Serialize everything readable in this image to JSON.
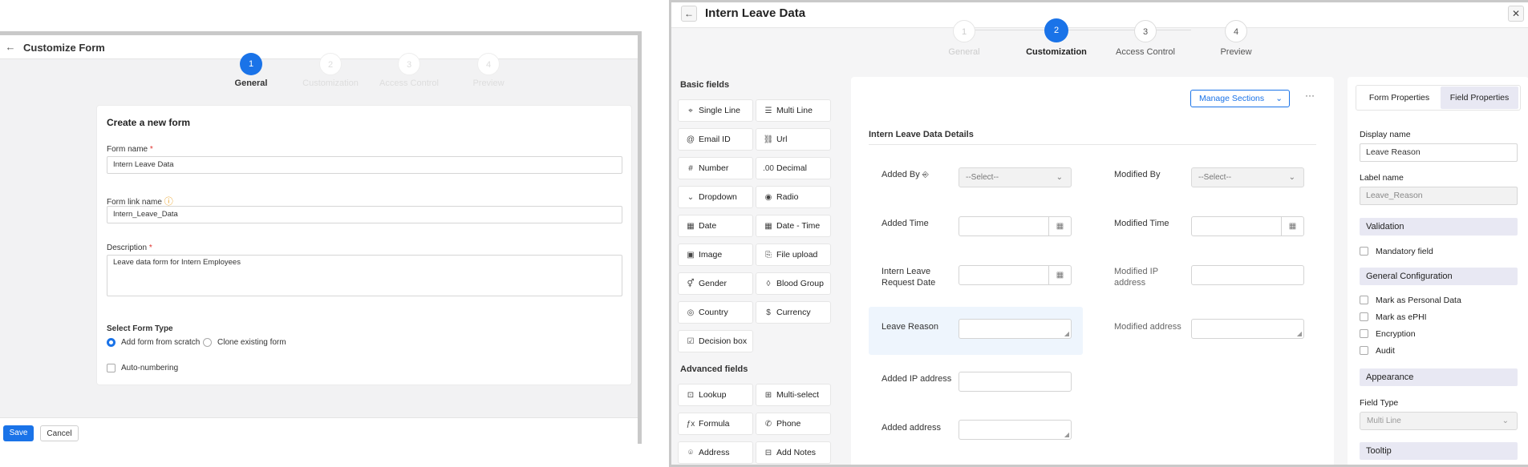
{
  "left": {
    "title": "Customize Form",
    "steps": [
      {
        "num": "1",
        "label": "General",
        "active": true
      },
      {
        "num": "2",
        "label": "Customization",
        "active": false
      },
      {
        "num": "3",
        "label": "Access Control",
        "active": false
      },
      {
        "num": "4",
        "label": "Preview",
        "active": false
      }
    ],
    "card_title": "Create a new form",
    "form_name_label": "Form name",
    "form_name_value": "Intern Leave Data",
    "form_link_label": "Form link name",
    "form_link_value": "Intern_Leave_Data",
    "description_label": "Description",
    "description_value": "Leave data form for Intern Employees",
    "form_type_label": "Select Form Type",
    "option_scratch": "Add form from scratch",
    "option_clone": "Clone existing form",
    "auto_numbering": "Auto-numbering",
    "save_label": "Save",
    "cancel_label": "Cancel",
    "required_mark": "*"
  },
  "right": {
    "title": "Intern Leave Data",
    "steps": [
      {
        "num": "1",
        "label": "General",
        "state": "done"
      },
      {
        "num": "2",
        "label": "Customization",
        "state": "active"
      },
      {
        "num": "3",
        "label": "Access Control",
        "state": "todo"
      },
      {
        "num": "4",
        "label": "Preview",
        "state": "todo"
      }
    ],
    "basic_fields_label": "Basic fields",
    "basic_fields": [
      {
        "label": "Single Line",
        "icon": "single-line-icon",
        "glyph": "⌖"
      },
      {
        "label": "Multi Line",
        "icon": "multi-line-icon",
        "glyph": "☰"
      },
      {
        "label": "Email ID",
        "icon": "at-icon",
        "glyph": "@"
      },
      {
        "label": "Url",
        "icon": "link-icon",
        "glyph": "⛓"
      },
      {
        "label": "Number",
        "icon": "hash-icon",
        "glyph": "#"
      },
      {
        "label": "Decimal",
        "icon": "decimal-icon",
        "glyph": ".00"
      },
      {
        "label": "Dropdown",
        "icon": "dropdown-icon",
        "glyph": "⌄"
      },
      {
        "label": "Radio",
        "icon": "radio-icon",
        "glyph": "◉"
      },
      {
        "label": "Date",
        "icon": "calendar-icon",
        "glyph": "▦"
      },
      {
        "label": "Date - Time",
        "icon": "datetime-icon",
        "glyph": "▦"
      },
      {
        "label": "Image",
        "icon": "image-icon",
        "glyph": "▣"
      },
      {
        "label": "File upload",
        "icon": "file-upload-icon",
        "glyph": "⎘"
      },
      {
        "label": "Gender",
        "icon": "gender-icon",
        "glyph": "⚥"
      },
      {
        "label": "Blood Group",
        "icon": "drop-icon",
        "glyph": "◊"
      },
      {
        "label": "Country",
        "icon": "globe-icon",
        "glyph": "◎"
      },
      {
        "label": "Currency",
        "icon": "currency-icon",
        "glyph": "$"
      },
      {
        "label": "Decision box",
        "icon": "checkbox-icon",
        "glyph": "☑"
      }
    ],
    "advanced_fields_label": "Advanced fields",
    "advanced_fields": [
      {
        "label": "Lookup",
        "icon": "lookup-icon",
        "glyph": "⊡"
      },
      {
        "label": "Multi-select",
        "icon": "multi-select-icon",
        "glyph": "⊞"
      },
      {
        "label": "Formula",
        "icon": "formula-icon",
        "glyph": "ƒx"
      },
      {
        "label": "Phone",
        "icon": "phone-icon",
        "glyph": "✆"
      },
      {
        "label": "Address",
        "icon": "location-icon",
        "glyph": "⌾"
      },
      {
        "label": "Add Notes",
        "icon": "notes-icon",
        "glyph": "⊟"
      }
    ],
    "manage_sections": "Manage Sections",
    "more": "···",
    "section_title": "Intern Leave Data Details",
    "select_placeholder": "--Select--",
    "fields": {
      "added_by": "Added By",
      "modified_by": "Modified By",
      "added_time": "Added Time",
      "modified_time": "Modified Time",
      "request_date_1": "Intern Leave",
      "request_date_2": "Request Date",
      "modified_ip_1": "Modified IP",
      "modified_ip_2": "address",
      "leave_reason": "Leave Reason",
      "modified_address": "Modified address",
      "added_ip": "Added IP address",
      "added_address": "Added address"
    },
    "props": {
      "tab_form": "Form Properties",
      "tab_field": "Field Properties",
      "display_name_label": "Display name",
      "display_name_value": "Leave Reason",
      "label_name_label": "Label name",
      "label_name_value": "Leave_Reason",
      "validation": "Validation",
      "mandatory": "Mandatory field",
      "general_config": "General Configuration",
      "personal_data": "Mark as Personal Data",
      "ephi": "Mark as ePHI",
      "encryption": "Encryption",
      "audit": "Audit",
      "appearance": "Appearance",
      "field_type_label": "Field Type",
      "field_type_value": "Multi Line",
      "tooltip": "Tooltip"
    }
  },
  "colors": {
    "accent": "#1a73e8",
    "section_bar": "#e8e8f3",
    "selected_field": "#eef5fd"
  }
}
